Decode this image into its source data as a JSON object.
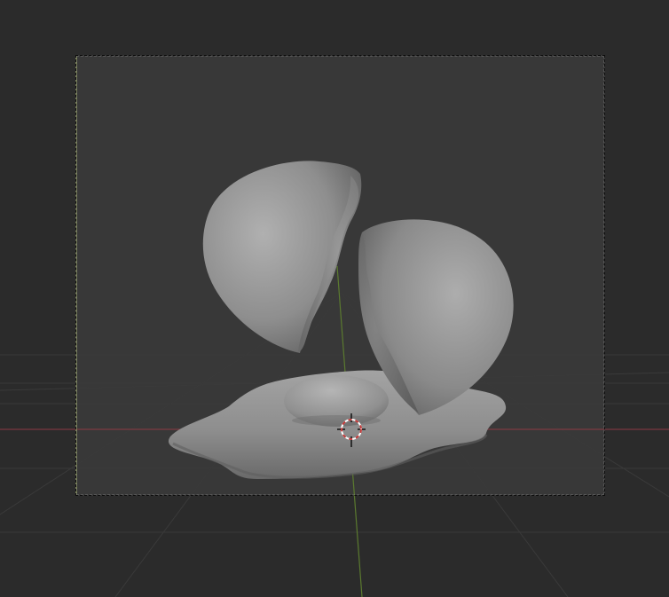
{
  "viewport": {
    "background_outside_camera": "#2b2b2b",
    "background_inside_camera": "#383838",
    "grid_line_color": "#3b3b3b",
    "x_axis_color": "#8e3a44",
    "y_axis_color": "#5b7a2f",
    "camera_frame_color": "#111111",
    "camera_left_edge_color": "#9ca86a"
  },
  "scene": {
    "objects": [
      {
        "name": "eggshell-top-left"
      },
      {
        "name": "eggshell-right"
      },
      {
        "name": "egg-white"
      },
      {
        "name": "egg-yolk"
      }
    ],
    "mesh_color": "#8f8f8f",
    "cursor": {
      "name": "3d-cursor",
      "ring_colors": [
        "#c43a3a",
        "#ffffff"
      ]
    }
  }
}
